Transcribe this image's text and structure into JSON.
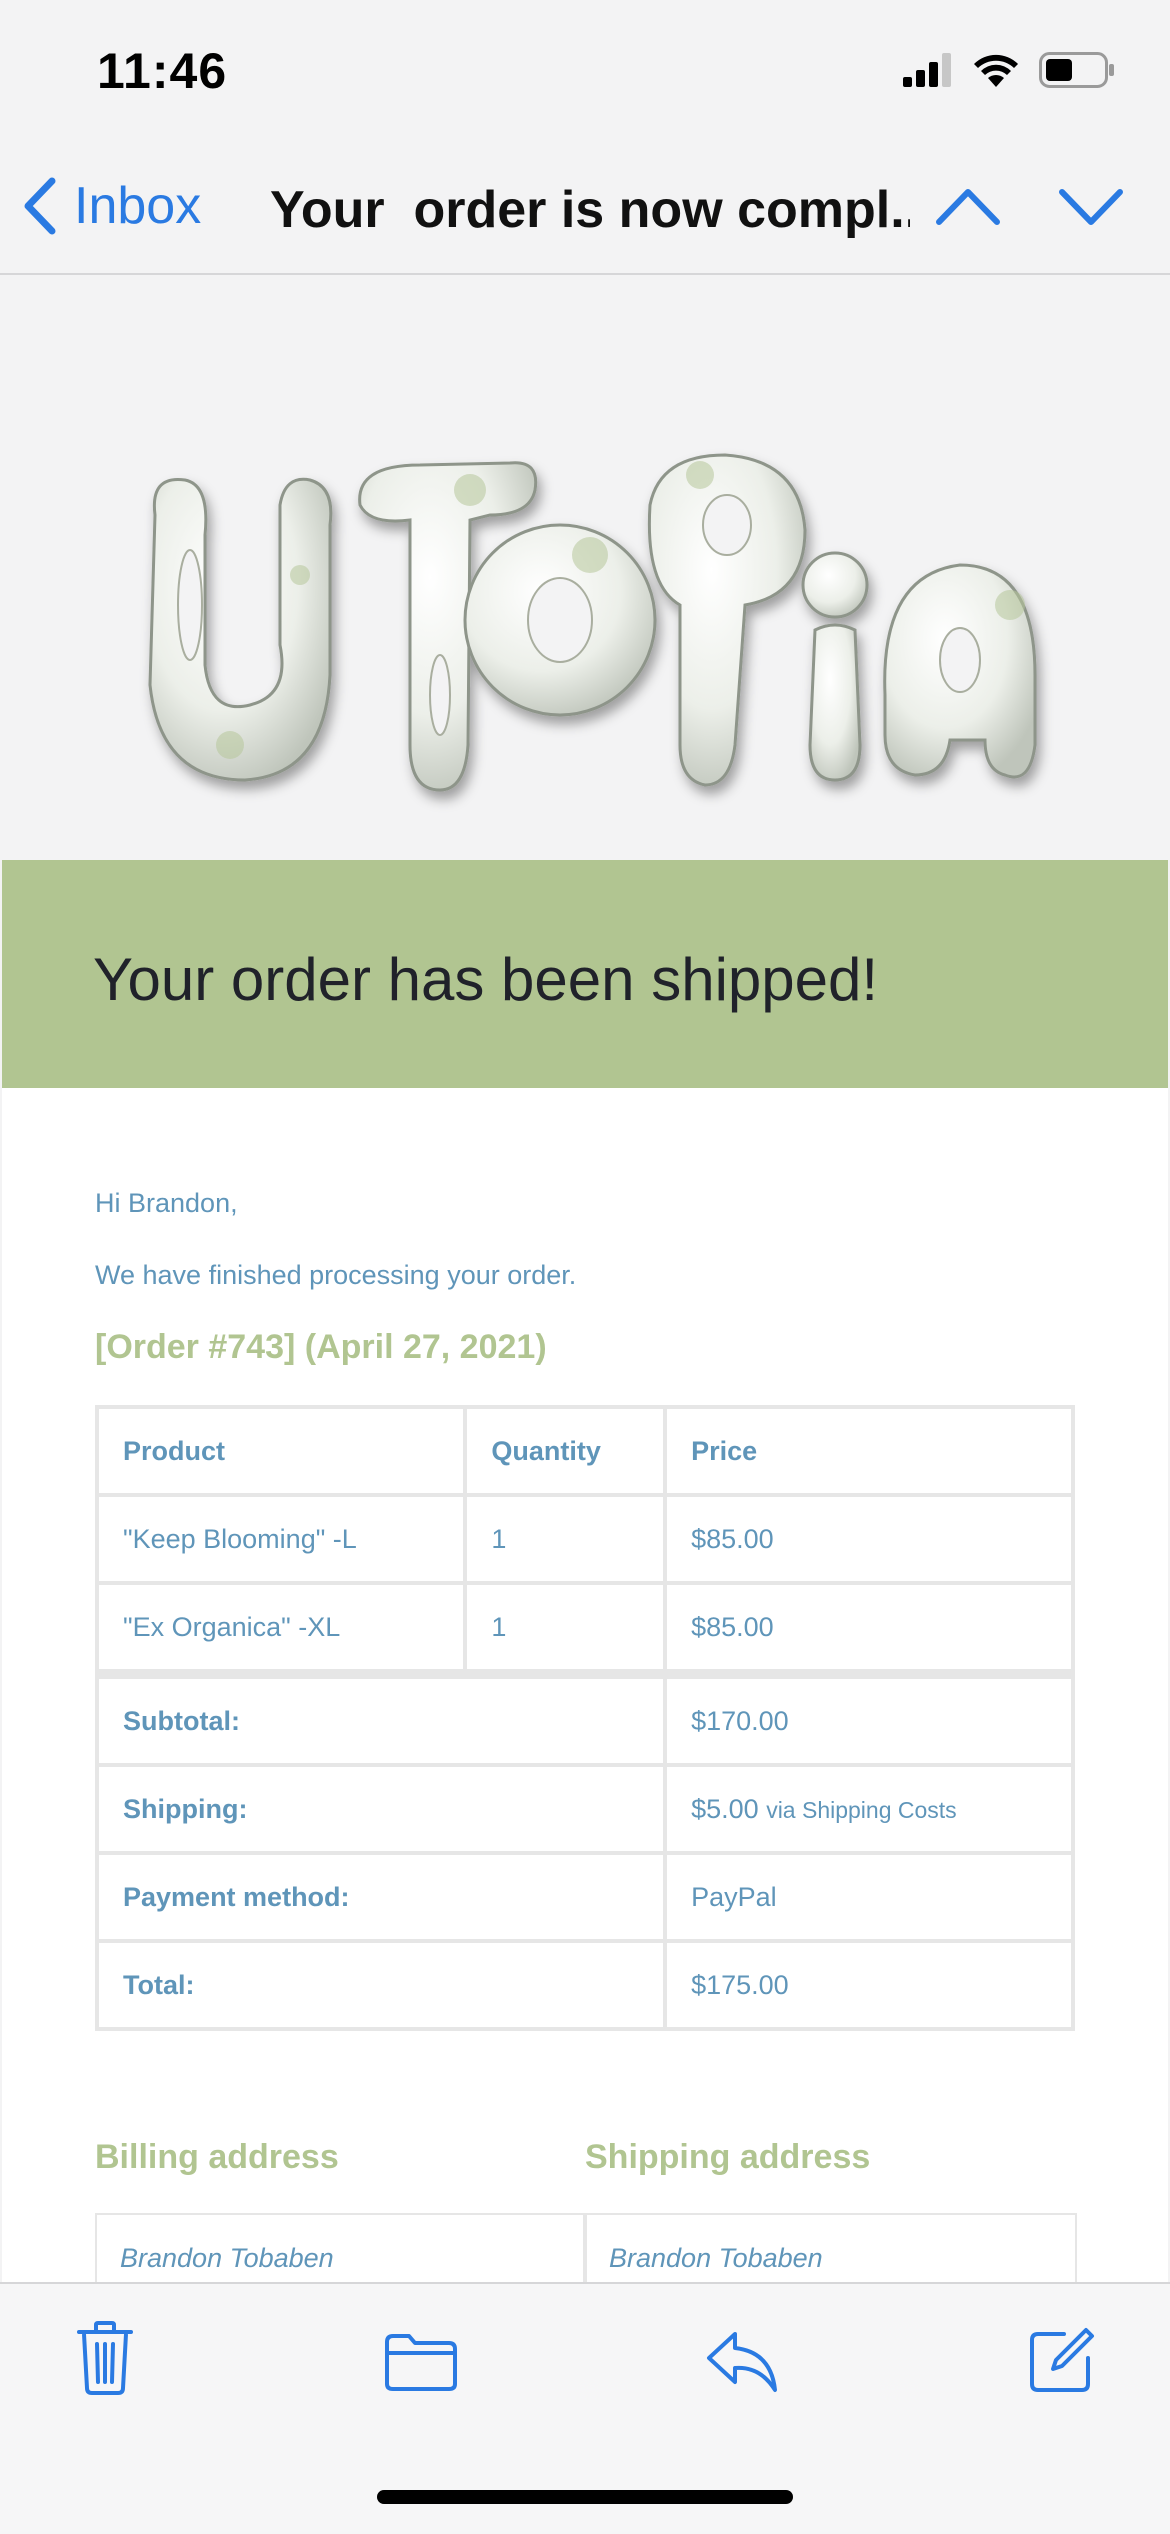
{
  "status_bar": {
    "time": "11:46"
  },
  "nav": {
    "back_label": "Inbox",
    "subject": "Your  order is now compl..."
  },
  "brand": {
    "logo_text": "UTOPIA"
  },
  "colors": {
    "accent": "#2a7ae2",
    "banner": "#b1c591",
    "text_blue": "#5f95b9",
    "heading_green": "#b1c591"
  },
  "email": {
    "banner_text": "Your order has been shipped!",
    "greeting": "Hi Brandon,",
    "intro": "We have finished processing your order.",
    "order_heading": "[Order #743] (April 27, 2021)",
    "table": {
      "headers": [
        "Product",
        "Quantity",
        "Price"
      ],
      "items": [
        {
          "product": "\"Keep Blooming\" -L",
          "quantity": "1",
          "price": "$85.00"
        },
        {
          "product": "\"Ex Organica\" -XL",
          "quantity": "1",
          "price": "$85.00"
        }
      ],
      "totals": [
        {
          "label": "Subtotal:",
          "value": "$170.00",
          "note": ""
        },
        {
          "label": "Shipping:",
          "value": "$5.00",
          "note": "via Shipping Costs"
        },
        {
          "label": "Payment method:",
          "value": "PayPal",
          "note": ""
        },
        {
          "label": "Total:",
          "value": "$175.00",
          "note": ""
        }
      ]
    },
    "billing": {
      "heading": "Billing address",
      "name": "Brandon Tobaben"
    },
    "shipping": {
      "heading": "Shipping address",
      "name": "Brandon Tobaben"
    }
  },
  "toolbar": {
    "icons": [
      "trash-icon",
      "folder-icon",
      "reply-icon",
      "compose-icon"
    ]
  }
}
